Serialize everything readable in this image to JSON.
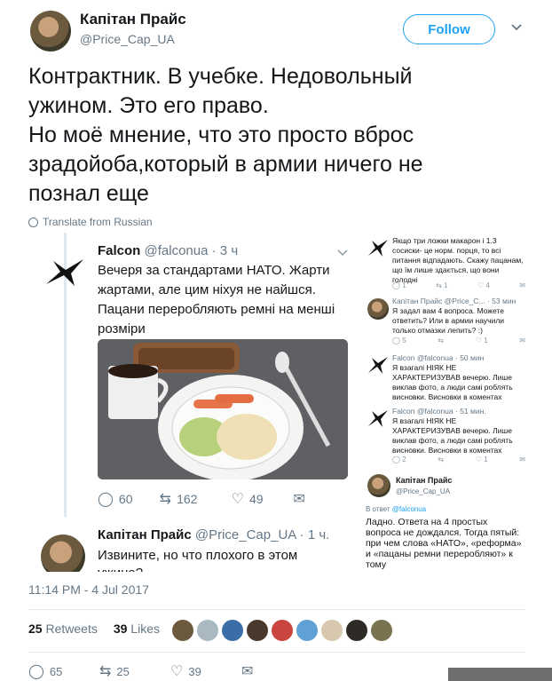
{
  "author": {
    "name": "Капітан Прайс",
    "handle": "@Price_Cap_UA"
  },
  "follow_label": "Follow",
  "tweet_lines": [
    "Контрактник. В учебке. Недовольный",
    "ужином. Это его право.",
    "Но моё мнение, что это просто вброс",
    "зрадойоба,который в армии ничего не",
    "познал еще"
  ],
  "translate_label": "Translate from Russian",
  "embedded": {
    "falcon": {
      "name": "Falcon",
      "handle": "@falconua",
      "time": "· 3 ч",
      "text": "Вечеря за стандартами НАТО. Жарти жартами, але цим ніхуя не найшся. Пацани переробляють ремні на менші розміри",
      "replies": "60",
      "retweets": "162",
      "likes": "49"
    },
    "reply": {
      "name": "Капітан Прайс",
      "handle": "@Price_Cap_UA",
      "time": "· 1 ч.",
      "text": "Извините, но что плохого в этом ужине?"
    },
    "side": [
      {
        "text": "Якщо три ложки макарон і 1.3 сосиски- це норм. порця, то всі питання відпадають. Скажу пацанам, що їм лише здається, що вони голодні",
        "counts": [
          "1",
          "1",
          "4",
          ""
        ]
      },
      {
        "meta": "Капітан Прайс @Price_C... · 53 мин",
        "text": "Я задал вам 4 вопроса. Можете ответить? Или в армии научили только отмазки лепить? :)",
        "counts": [
          "5",
          "",
          "1",
          ""
        ]
      },
      {
        "meta": "Falcon @falconua · 50 мин",
        "text": "Я взагалі НІЯК НЕ ХАРАКТЕРИЗУВАВ вечерю. Лише виклав фото, а люди самі роблять висновки. Висновки в коментах",
        "counts": []
      },
      {
        "meta": "Falcon @falconua · 51 мин.",
        "text": "Я взагалі НІЯК НЕ ХАРАКТЕРИЗУВАВ вечерю. Лише виклав фото, а люди самі роблять висновки. Висновки в коментах",
        "counts": [
          "2",
          "",
          "1",
          ""
        ]
      }
    ],
    "side_last": {
      "name": "Капітан Прайс",
      "handle": "@Price_Cap_UA",
      "reply_to_prefix": "В ответ",
      "reply_to": "@falconua",
      "text": "Ладно. Ответа на 4 простых вопроса не дождался. Тогда пятый: при чем слова «НАТО», «реформа» и «пацаны ремни переробляют» к тому"
    }
  },
  "timestamp": "11:14 PM - 4 Jul 2017",
  "stats": {
    "retweets_count": "25",
    "retweets_label": "Retweets",
    "likes_count": "39",
    "likes_label": "Likes"
  },
  "actions": {
    "replies": "65",
    "retweets": "25",
    "likes": "39"
  },
  "colors": {
    "accent": "#1da1f2",
    "text": "#14171a",
    "muted": "#657786"
  }
}
